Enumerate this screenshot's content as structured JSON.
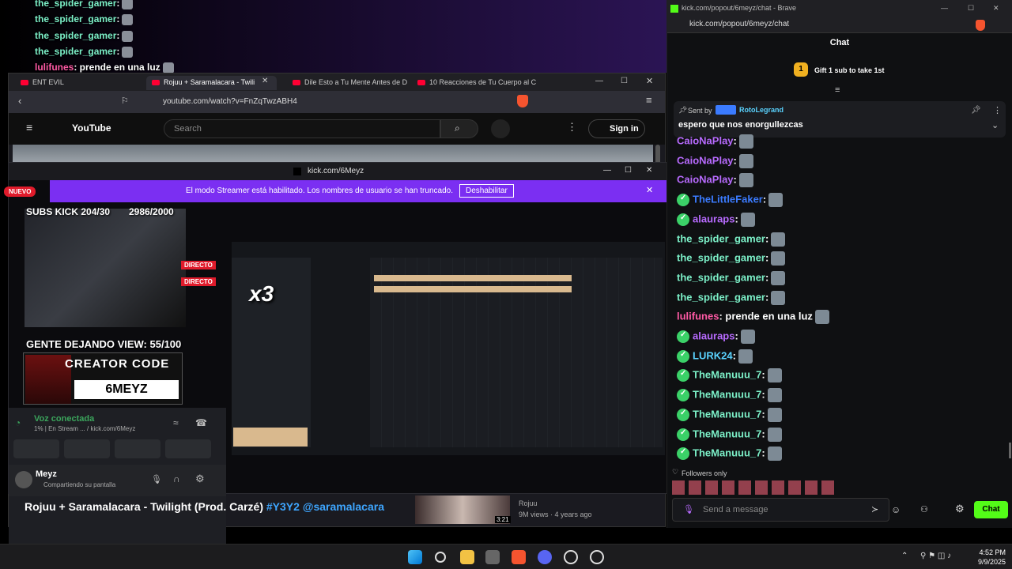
{
  "overlay_chat": [
    {
      "user": "the_spider_gamer",
      "msg": ":",
      "color": "#7cf0c8"
    },
    {
      "user": "the_spider_gamer",
      "msg": ":",
      "color": "#7cf0c8"
    },
    {
      "user": "the_spider_gamer",
      "msg": ":",
      "color": "#7cf0c8"
    },
    {
      "user": "the_spider_gamer",
      "msg": ":",
      "color": "#7cf0c8"
    },
    {
      "user": "lulifunes",
      "msg": ": prende en una luz",
      "color": "#ff5aa5"
    },
    {
      "user": "alauraps",
      "msg": ":",
      "color": "#b86bff"
    },
    {
      "user": "LURK24",
      "msg": ":",
      "color": "#5ad3ff"
    },
    {
      "user": "TheManuuu_7",
      "msg": ":",
      "color": "#7cf0c8"
    },
    {
      "user": "TheManuuu_7",
      "msg": ":",
      "color": "#7cf0c8"
    },
    {
      "user": "TheManuuu_7",
      "msg": ":",
      "color": "#7cf0c8"
    },
    {
      "user": "TheManuuu_7",
      "msg": ":",
      "color": "#7cf0c8"
    },
    {
      "user": "TheManuuu_7",
      "msg": ":",
      "color": "#7cf0c8"
    }
  ],
  "yt_window": {
    "tabs": [
      "ENT EVIL",
      "Rojuu + Saramalacara - Twili",
      "Dile Esto a Tu Mente Antes de D",
      "10 Reacciones de Tu Cuerpo al C"
    ],
    "url": "youtube.com/watch?v=FnZqTwzABH4",
    "logo": "YouTube",
    "search_placeholder": "Search",
    "sign_in": "Sign in",
    "video_title": "Rojuu + Saramalacara - Twilight (Prod. Carzé)",
    "hashtag": "#Y3Y2",
    "mention": "@saramalacara",
    "related_channel": "Rojuu",
    "related_meta": "9M views · 4 years ago",
    "related_duration": "3:21"
  },
  "kick_window": {
    "title": "kick.com/6Meyz",
    "banner": "El modo Streamer está habilitado. Los nombres de usuario se han truncado.",
    "banner_button": "Deshabilitar",
    "nuevo": "NUEVO",
    "subs": "SUBS KICK 204/30",
    "goal": "2986/2000",
    "directo": "DIRECTO",
    "gente": "GENTE DEJANDO VIEW: 55/100",
    "creator_code_label": "CREATOR CODE",
    "creator_code": "6MEYZ",
    "x3": "x3",
    "voice": "Voz conectada",
    "voice_sub": "1% | En Stream ... / kick.com/6Meyz",
    "user": "Meyz",
    "user_status": "Compartiendo su pantalla"
  },
  "chat_window": {
    "title": "kick.com/popout/6meyz/chat - Brave",
    "url": "kick.com/popout/6meyz/chat",
    "header": "Chat",
    "gift": "Gift 1 sub to take 1st",
    "pinned_by_label": "Sent by",
    "pinned_by": "RotoLegrand",
    "pinned_msg": "espero que nos enorgullezcas",
    "messages": [
      {
        "user": "CaioNaPlay",
        "color": "#b86bff",
        "msg": ":",
        "verified": false
      },
      {
        "user": "CaioNaPlay",
        "color": "#b86bff",
        "msg": ":",
        "verified": false
      },
      {
        "user": "CaioNaPlay",
        "color": "#b86bff",
        "msg": ":",
        "verified": false
      },
      {
        "user": "TheLittleFaker",
        "color": "#3b7bff",
        "msg": ":",
        "verified": true
      },
      {
        "user": "alauraps",
        "color": "#b86bff",
        "msg": ":",
        "verified": true
      },
      {
        "user": "the_spider_gamer",
        "color": "#7cf0c8",
        "msg": ":",
        "verified": false
      },
      {
        "user": "the_spider_gamer",
        "color": "#7cf0c8",
        "msg": ":",
        "verified": false
      },
      {
        "user": "the_spider_gamer",
        "color": "#7cf0c8",
        "msg": ":",
        "verified": false
      },
      {
        "user": "the_spider_gamer",
        "color": "#7cf0c8",
        "msg": ":",
        "verified": false
      },
      {
        "user": "lulifunes",
        "color": "#ff5aa5",
        "msg": ": prende en una luz",
        "verified": false
      },
      {
        "user": "alauraps",
        "color": "#b86bff",
        "msg": ":",
        "verified": true
      },
      {
        "user": "LURK24",
        "color": "#5ad3ff",
        "msg": ":",
        "verified": true
      },
      {
        "user": "TheManuuu_7",
        "color": "#7cf0c8",
        "msg": ":",
        "verified": true
      },
      {
        "user": "TheManuuu_7",
        "color": "#7cf0c8",
        "msg": ":",
        "verified": true
      },
      {
        "user": "TheManuuu_7",
        "color": "#7cf0c8",
        "msg": ":",
        "verified": true
      },
      {
        "user": "TheManuuu_7",
        "color": "#7cf0c8",
        "msg": ":",
        "verified": true
      },
      {
        "user": "TheManuuu_7",
        "color": "#7cf0c8",
        "msg": ":",
        "verified": true
      }
    ],
    "followers_only": "Followers only",
    "input_placeholder": "Send a message",
    "send_button": "Chat"
  },
  "taskbar": {
    "time": "4:52 PM",
    "date": "9/9/2025"
  }
}
